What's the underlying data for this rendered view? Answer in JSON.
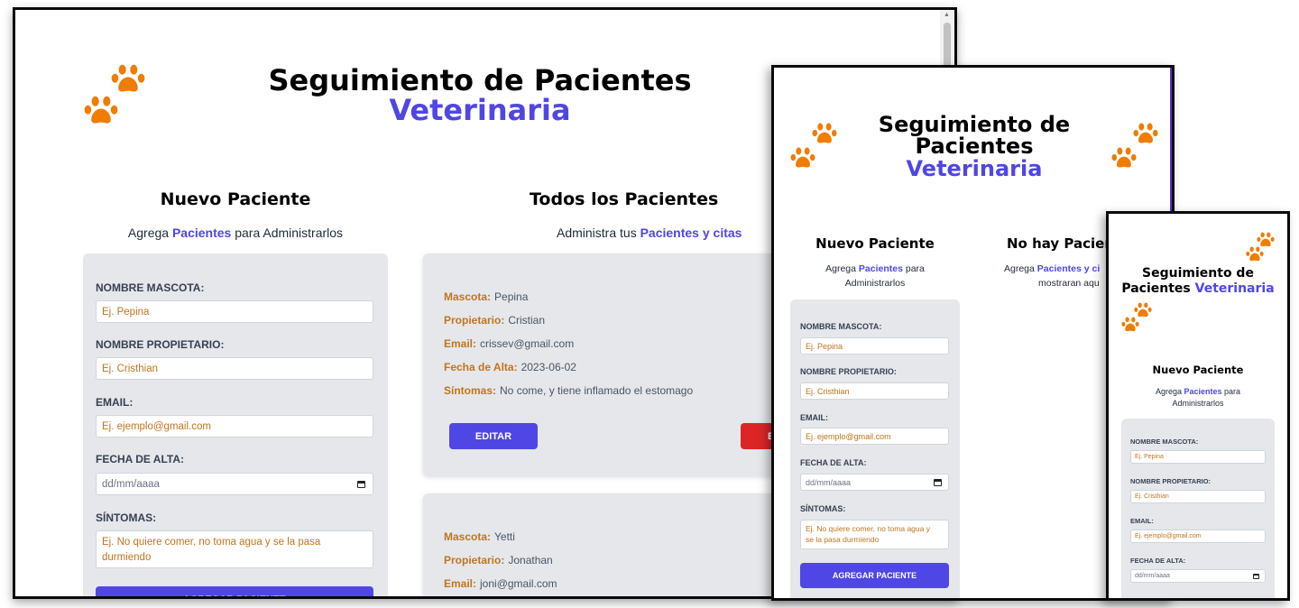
{
  "app": {
    "title_line1": "Seguimiento de Pacientes",
    "title_tablet_line1": "Seguimiento de",
    "title_tablet_line2": "Pacientes",
    "title_phone_line1": "Seguimiento de",
    "title_phone_line2": "Pacientes",
    "title_accent": "Veterinaria"
  },
  "form": {
    "title": "Nuevo Paciente",
    "subtitle_pre": "Agrega",
    "subtitle_accent": "Pacientes",
    "subtitle_post": "para Administrarlos",
    "subtitle_post_short": "para",
    "subtitle_post_line2": "Administrarlos",
    "pet_label": "Nombre Mascota:",
    "pet_placeholder": "Ej. Pepina",
    "owner_label": "Nombre Propietario:",
    "owner_placeholder": "Ej. Cristhian",
    "email_label": "Email:",
    "email_placeholder": "Ej. ejemplo@gmail.com",
    "date_label": "Fecha de Alta:",
    "date_placeholder": "dd/mm/aaaa",
    "symptoms_label": "Síntomas:",
    "symptoms_placeholder_line1": "Ej. No quiere comer, no toma agua y se la pasa",
    "symptoms_placeholder_line2": "durmiendo",
    "symptoms_placeholder_tablet_line1": "Ej. No quiere comer, no toma agua y",
    "symptoms_placeholder_tablet_line2": "se la pasa durmiendo",
    "submit_label": "Agregar Paciente"
  },
  "list": {
    "title": "Todos los Pacientes",
    "subtitle_pre": "Administra tus",
    "subtitle_accent": "Pacientes y citas",
    "empty_title_visible": "No hay Pacien",
    "empty_sub_pre": "Agrega",
    "empty_sub_accent": "Pacientes y ci",
    "empty_sub_line2": "mostraran aqu",
    "keys": {
      "pet": "Mascota:",
      "owner": "Propietario:",
      "email": "Email:",
      "date": "Fecha de Alta:",
      "symptoms": "Síntomas:"
    },
    "patients": [
      {
        "pet": "Pepina",
        "owner": "Cristian",
        "email": "crissev@gmail.com",
        "date": "2023-06-02",
        "symptoms": "No come, y tiene inflamado el estomago"
      },
      {
        "pet": "Yetti",
        "owner": "Jonathan",
        "email": "joni@gmail.com"
      }
    ],
    "edit_label": "Editar",
    "delete_label_visible": "E"
  },
  "colors": {
    "accent": "#4f46e5",
    "paw": "#f07c00",
    "label_orange": "#c2741d",
    "danger": "#dc2626",
    "card_bg": "#e5e7eb"
  },
  "icons": [
    "paw-icon",
    "calendar-icon",
    "scroll-up-arrow"
  ]
}
